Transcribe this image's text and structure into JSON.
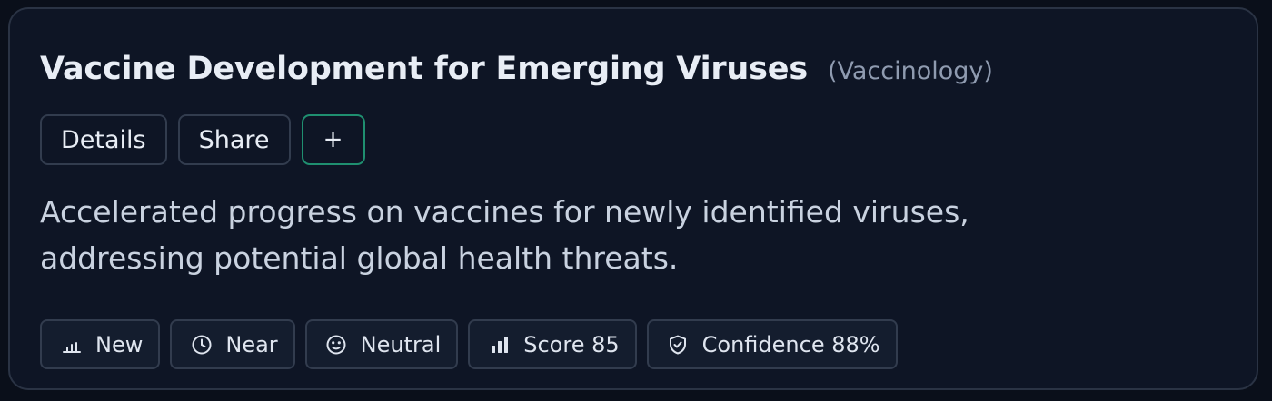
{
  "card": {
    "title": "Vaccine Development for Emerging Viruses",
    "category": "(Vaccinology)",
    "actions": {
      "details_label": "Details",
      "share_label": "Share",
      "add_label": "+"
    },
    "description": "Accelerated progress on vaccines for newly identified viruses, addressing potential global health threats.",
    "tags": [
      {
        "icon": "bar-chart-low-icon",
        "label": "New"
      },
      {
        "icon": "clock-icon",
        "label": "Near"
      },
      {
        "icon": "neutral-face-icon",
        "label": "Neutral"
      },
      {
        "icon": "bar-chart-icon",
        "label": "Score 85"
      },
      {
        "icon": "shield-check-icon",
        "label": "Confidence 88%"
      }
    ]
  },
  "colors": {
    "background": "#0a0f1a",
    "card": "#0e1525",
    "border": "#2a3344",
    "accent": "#1f8f70",
    "title": "#e8edf5",
    "muted": "#8f9bb0"
  }
}
